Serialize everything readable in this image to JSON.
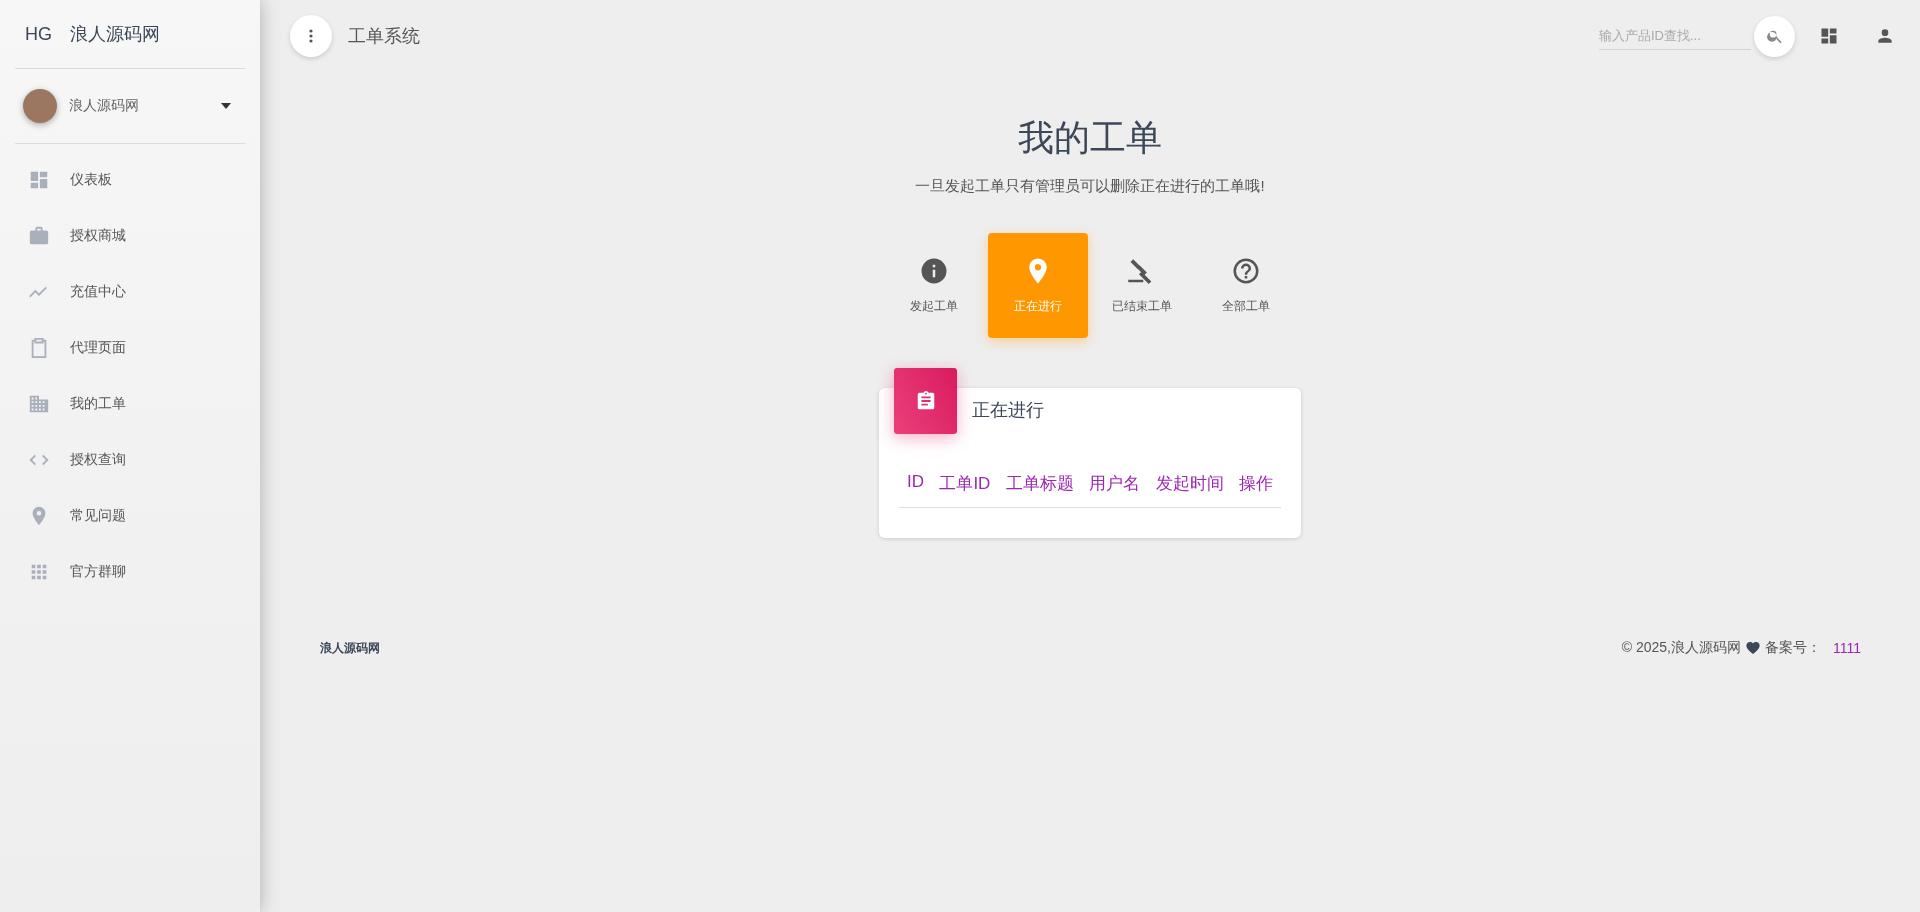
{
  "sidebar": {
    "logo_mark": "HG",
    "logo_text": "浪人源码网",
    "user": {
      "name": "浪人源码网"
    },
    "items": [
      {
        "label": "仪表板",
        "selected": false
      },
      {
        "label": "授权商城",
        "selected": false
      },
      {
        "label": "充值中心",
        "selected": false
      },
      {
        "label": "代理页面",
        "selected": false
      },
      {
        "label": "我的工单",
        "selected": false
      },
      {
        "label": "授权查询",
        "selected": false
      },
      {
        "label": "常见问题",
        "selected": false
      },
      {
        "label": "官方群聊",
        "selected": false
      }
    ]
  },
  "topbar": {
    "title": "工单系统",
    "search": {
      "placeholder": "输入产品ID查找..."
    }
  },
  "page": {
    "title": "我的工单",
    "subtitle": "一旦发起工单只有管理员可以删除正在进行的工单哦!"
  },
  "tabs": [
    {
      "label": "发起工单",
      "selected": false
    },
    {
      "label": "正在进行",
      "selected": true
    },
    {
      "label": "已结束工单",
      "selected": false
    },
    {
      "label": "全部工单",
      "selected": false
    }
  ],
  "card": {
    "title": "正在进行",
    "table": {
      "columns": [
        "ID",
        "工单ID",
        "工单标题",
        "用户名",
        "发起时间",
        "操作"
      ]
    }
  },
  "footer": {
    "left": "浪人源码网",
    "copyright": "© 2025,浪人源码网",
    "record_label": "备案号：",
    "record_number": "1111"
  }
}
